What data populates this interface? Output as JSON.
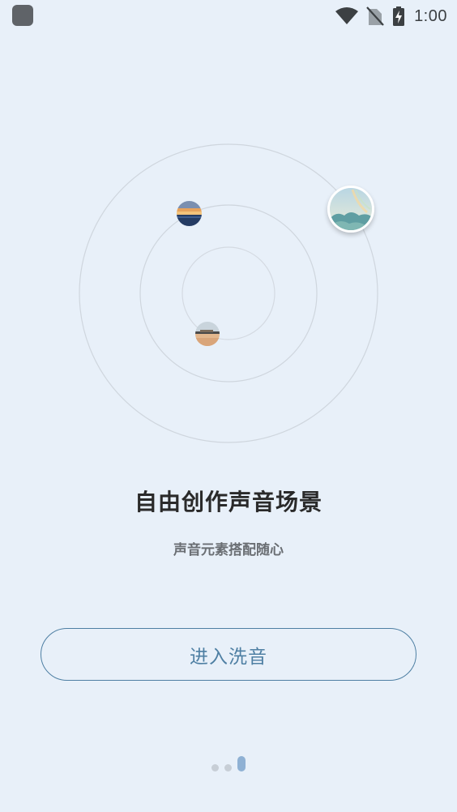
{
  "status_bar": {
    "time": "1:00",
    "icons": [
      "app-indicator-icon",
      "wifi-icon",
      "no-sim-icon",
      "battery-charging-icon"
    ]
  },
  "onboarding": {
    "title": "自由创作声音场景",
    "subtitle": "声音元素搭配随心",
    "enter_button_label": "进入洗音",
    "page_indicator": {
      "total": 3,
      "current": 3
    }
  },
  "colors": {
    "background": "#e8f0f9",
    "accent": "#4e7fa3",
    "indicator_active": "#8fb1d4",
    "indicator_inactive": "#c7ced6"
  }
}
